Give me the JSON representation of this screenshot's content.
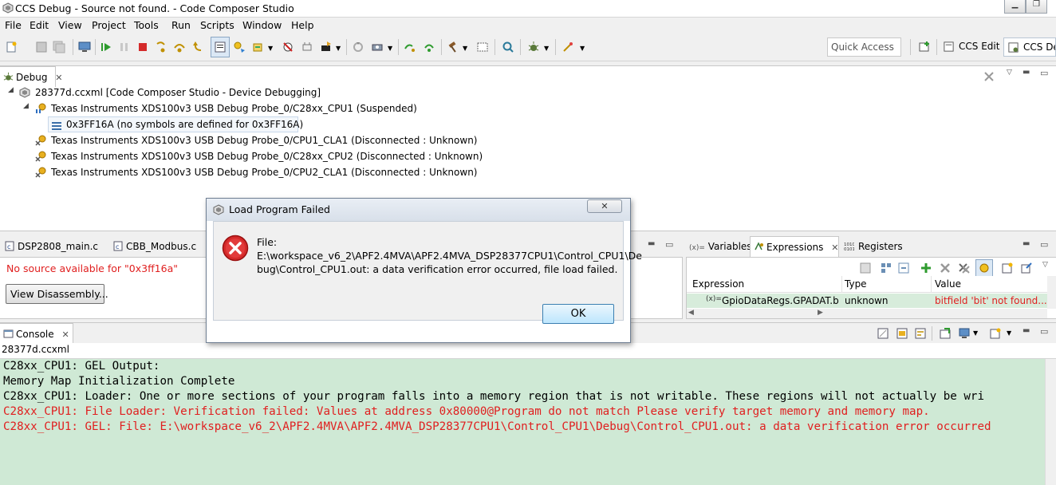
{
  "window": {
    "title": "CCS Debug - Source not found. - Code Composer Studio",
    "controls": [
      "minimize",
      "maximize"
    ]
  },
  "menubar": {
    "items": [
      "File",
      "Edit",
      "View",
      "Project",
      "Tools",
      "Run",
      "Scripts",
      "Window",
      "Help"
    ]
  },
  "toolbar": {
    "quick_access_placeholder": "Quick Access",
    "perspectives": [
      "CCS Edit",
      "CCS De"
    ]
  },
  "debug_view": {
    "tab_label": "Debug",
    "tree": [
      {
        "label": "28377d.ccxml [Code Composer Studio - Device Debugging]",
        "level": 0,
        "icon": "launch-config-icon"
      },
      {
        "label": "Texas Instruments XDS100v3 USB Debug Probe_0/C28xx_CPU1 (Suspended)",
        "level": 1,
        "icon": "cpu-suspended-icon"
      },
      {
        "label": "0x3FF16A  (no symbols are defined for 0x3FF16A)",
        "level": 2,
        "icon": "stack-frame-icon"
      },
      {
        "label": "Texas Instruments XDS100v3 USB Debug Probe_0/CPU1_CLA1 (Disconnected : Unknown)",
        "level": 1,
        "icon": "cpu-disconnected-icon"
      },
      {
        "label": "Texas Instruments XDS100v3 USB Debug Probe_0/C28xx_CPU2 (Disconnected : Unknown)",
        "level": 1,
        "icon": "cpu-disconnected-icon"
      },
      {
        "label": "Texas Instruments XDS100v3 USB Debug Probe_0/CPU2_CLA1 (Disconnected : Unknown)",
        "level": 1,
        "icon": "cpu-disconnected-icon"
      }
    ]
  },
  "editor": {
    "tabs": [
      "DSP2808_main.c",
      "CBB_Modbus.c"
    ],
    "message": "No source available for \"0x3ff16a\"",
    "view_disassembly_label": "View Disassembly..."
  },
  "expressions": {
    "tabs": [
      "Variables",
      "Expressions",
      "Registers"
    ],
    "tab_prefix_variables": "(x)=",
    "tab_prefix_registers": "1010\n0101",
    "columns": [
      "Expression",
      "Type",
      "Value"
    ],
    "rows": [
      {
        "expression": "GpioDataRegs.GPADAT.b",
        "prefix": "(x)=",
        "type": "unknown",
        "value": "bitfield 'bit' not found..."
      }
    ]
  },
  "console": {
    "tab_label": "Console",
    "subtitle": "28377d.ccxml",
    "lines": [
      {
        "text": "C28xx_CPU1: GEL Output:",
        "color": "#000000"
      },
      {
        "text": "Memory Map Initialization Complete",
        "color": "#000000"
      },
      {
        "text": "C28xx_CPU1: Loader: One or more sections of your program falls into a memory region that is not writable.  These regions will not actually be wri",
        "color": "#000000"
      },
      {
        "text": "C28xx_CPU1: File Loader: Verification failed: Values at address 0x80000@Program do not match Please verify target memory and memory map.",
        "color": "#e01f1f"
      },
      {
        "text": "C28xx_CPU1: GEL: File: E:\\workspace_v6_2\\APF2.4MVA\\APF2.4MVA_DSP28377CPU1\\Control_CPU1\\Debug\\Control_CPU1.out: a data verification error occurred",
        "color": "#e01f1f"
      }
    ]
  },
  "dialog": {
    "title": "Load Program Failed",
    "close_label": "✕",
    "message_lines": [
      "File:",
      "E:\\workspace_v6_2\\APF2.4MVA\\APF2.4MVA_DSP28377CPU1\\Control_CPU1\\De",
      "bug\\Control_CPU1.out: a data verification error occurred, file load failed."
    ],
    "ok_label": "OK"
  },
  "colors": {
    "error_red": "#e01f1f",
    "console_bg": "#cfe9d5",
    "dialog_accent": "#3c7fb1"
  }
}
